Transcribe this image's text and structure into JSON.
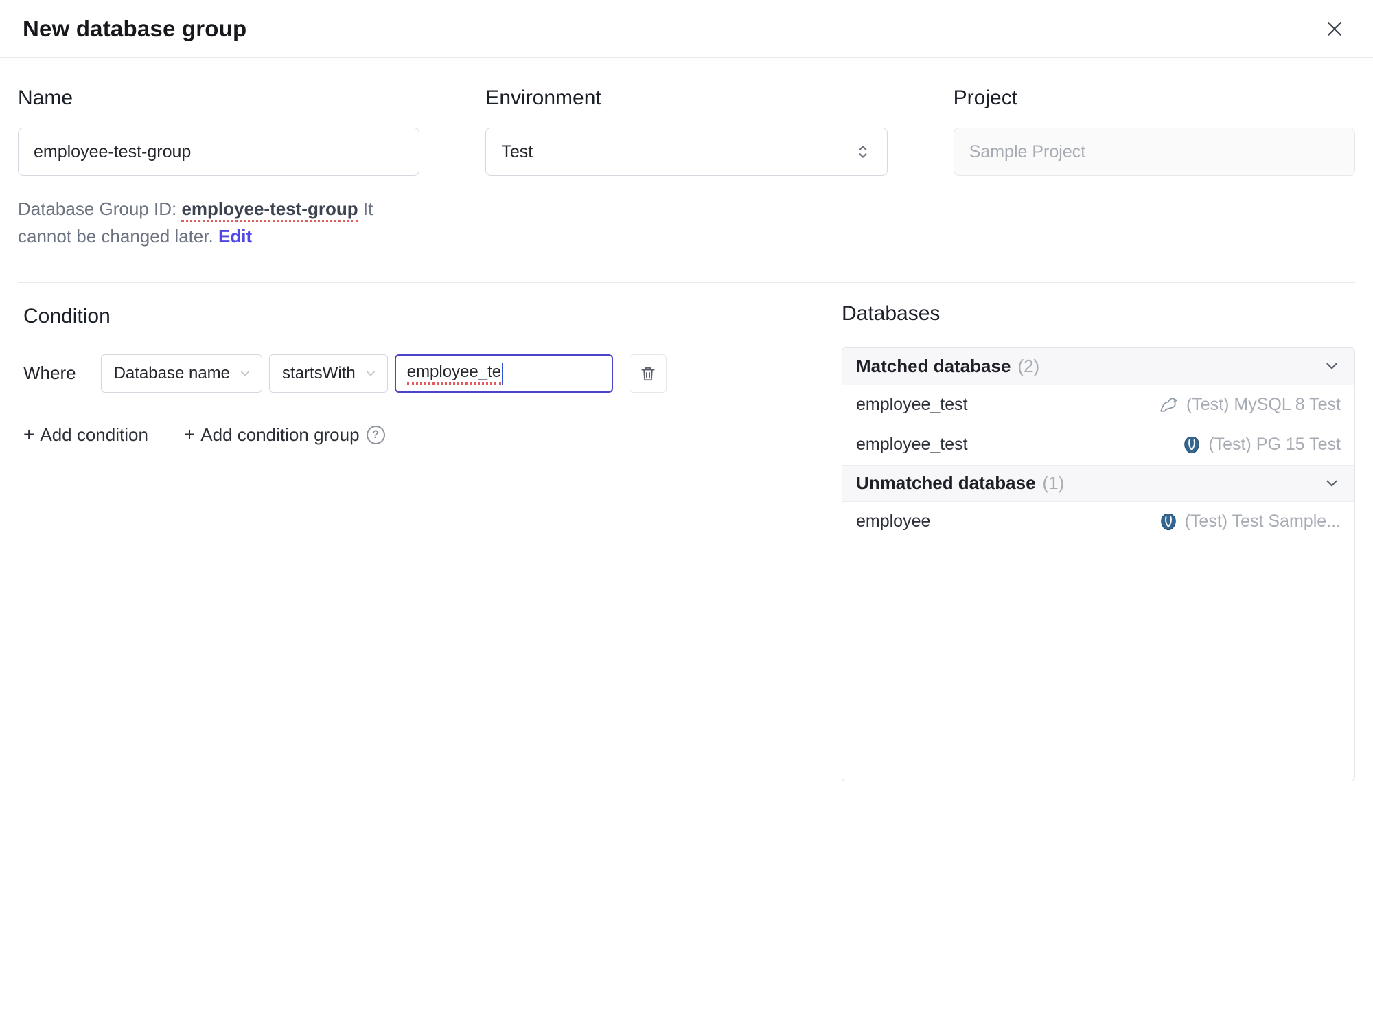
{
  "dialog": {
    "title": "New database group"
  },
  "form": {
    "name": {
      "label": "Name",
      "value": "employee-test-group"
    },
    "environment": {
      "label": "Environment",
      "value": "Test"
    },
    "project": {
      "label": "Project",
      "placeholder": "Sample Project"
    },
    "group_id_help": {
      "prefix": "Database Group ID:",
      "id": "employee-test-group",
      "suffix": "It cannot be changed later.",
      "edit_label": "Edit"
    }
  },
  "condition": {
    "heading": "Condition",
    "where_label": "Where",
    "field_select": "Database name",
    "operator_select": "startsWith",
    "value": "employee_te",
    "add_condition_label": "Add condition",
    "add_condition_group_label": "Add condition group",
    "help_glyph": "?"
  },
  "databases": {
    "heading": "Databases",
    "groups": [
      {
        "title": "Matched database",
        "count": "(2)",
        "rows": [
          {
            "name": "employee_test",
            "icon": "mysql-icon",
            "instance": "(Test) MySQL 8 Test"
          },
          {
            "name": "employee_test",
            "icon": "postgresql-icon",
            "instance": "(Test) PG 15 Test"
          }
        ]
      },
      {
        "title": "Unmatched database",
        "count": "(1)",
        "rows": [
          {
            "name": "employee",
            "icon": "postgresql-icon",
            "instance": "(Test) Test Sample..."
          }
        ]
      }
    ]
  },
  "colors": {
    "accent": "#4f46e5",
    "focus_border": "#4d43c9",
    "spellcheck_underline": "#e35b5b",
    "muted_text": "#a7abb3",
    "panel_header_bg": "#f7f7f9",
    "border": "#e4e5ea",
    "postgres_blue": "#336791",
    "mysql_gray": "#8b98a5"
  }
}
